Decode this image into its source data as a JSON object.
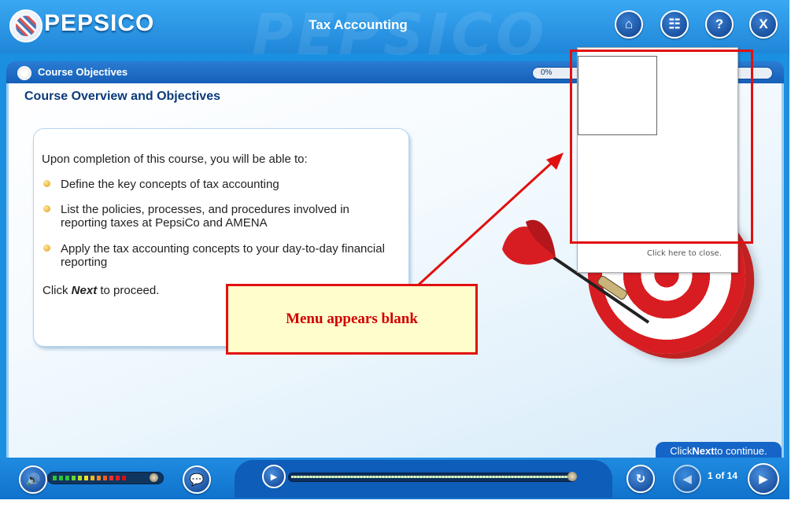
{
  "header": {
    "brand": "PEPSICO",
    "watermark": "PEPSICO",
    "title": "Tax Accounting",
    "buttons": [
      {
        "icon": "home-icon",
        "glyph": "⌂"
      },
      {
        "icon": "sitemap-icon",
        "glyph": "☷"
      },
      {
        "icon": "help-icon",
        "glyph": "?"
      },
      {
        "icon": "close-icon",
        "glyph": "X"
      }
    ]
  },
  "section": {
    "label": "Course Objectives",
    "progress_label": "0%",
    "progress": 0
  },
  "content": {
    "subtitle": "Course Overview and Objectives",
    "intro": "Upon completion of this course, you will be able to:",
    "objectives": [
      "Define the key concepts of tax accounting",
      "List the policies, processes, and procedures involved in reporting taxes at PepsiCo and AMENA",
      "Apply the tax accounting concepts to your day-to-day financial reporting"
    ],
    "cta_prefix": "Click ",
    "cta_bold": "Next",
    "cta_suffix": " to proceed."
  },
  "menu": {
    "close_text": "Click here to close."
  },
  "annotation": {
    "callout": "Menu appears blank",
    "color": "#e11010"
  },
  "footer": {
    "next_hint_prefix": "Click ",
    "next_hint_bold": "Next",
    "next_hint_suffix": " to continue.",
    "page_count": "1 of 14",
    "volume_level": 0.9,
    "scrub_progress": 1.0
  },
  "colors": {
    "primary_blue": "#1b8fe0",
    "dark_blue": "#0b3a7a",
    "accent_red": "#d81d22"
  }
}
